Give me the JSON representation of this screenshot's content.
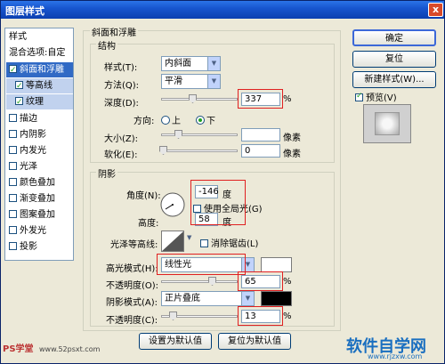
{
  "window": {
    "title": "图层样式",
    "close": "x"
  },
  "sidebar": {
    "items": [
      {
        "label": "样式",
        "checkbox": false
      },
      {
        "label": "混合选项:自定",
        "checkbox": false
      },
      {
        "label": "斜面和浮雕",
        "checkbox": true,
        "checked": true
      },
      {
        "label": "等高线",
        "checkbox": true,
        "checked": true
      },
      {
        "label": "纹理",
        "checkbox": true,
        "checked": true
      },
      {
        "label": "描边",
        "checkbox": true,
        "checked": false
      },
      {
        "label": "内阴影",
        "checkbox": true,
        "checked": false
      },
      {
        "label": "内发光",
        "checkbox": true,
        "checked": false
      },
      {
        "label": "光泽",
        "checkbox": true,
        "checked": false
      },
      {
        "label": "颜色叠加",
        "checkbox": true,
        "checked": false
      },
      {
        "label": "渐变叠加",
        "checkbox": true,
        "checked": false
      },
      {
        "label": "图案叠加",
        "checkbox": true,
        "checked": false
      },
      {
        "label": "外发光",
        "checkbox": true,
        "checked": false
      },
      {
        "label": "投影",
        "checkbox": true,
        "checked": false
      }
    ]
  },
  "bevel": {
    "section_title": "斜面和浮雕",
    "structure_title": "结构",
    "style_label": "样式(T):",
    "style_value": "内斜面",
    "method_label": "方法(Q):",
    "method_value": "平滑",
    "depth_label": "深度(D):",
    "depth_value": "337",
    "depth_unit": "%",
    "direction_label": "方向:",
    "direction_up": "上",
    "direction_down": "下",
    "size_label": "大小(Z):",
    "size_value": "",
    "size_unit": "像素",
    "soften_label": "软化(E):",
    "soften_value": "0",
    "soften_unit": "像素"
  },
  "shading": {
    "title": "阴影",
    "angle_label": "角度(N):",
    "angle_value": "-146",
    "angle_unit": "度",
    "global_light_label": "使用全局光(G)",
    "altitude_label": "高度:",
    "altitude_value": "58",
    "altitude_unit": "度",
    "gloss_contour_label": "光泽等高线:",
    "antialias_label": "消除锯齿(L)",
    "highlight_mode_label": "高光模式(H):",
    "highlight_mode_value": "线性光",
    "highlight_opacity_label": "不透明度(O):",
    "highlight_opacity_value": "65",
    "highlight_opacity_unit": "%",
    "shadow_mode_label": "阴影模式(A):",
    "shadow_mode_value": "正片叠底",
    "shadow_opacity_label": "不透明度(C):",
    "shadow_opacity_value": "13",
    "shadow_opacity_unit": "%"
  },
  "buttons": {
    "make_default": "设置为默认值",
    "reset_default": "复位为默认值",
    "ok": "确定",
    "reset": "复位",
    "new_style": "新建样式(W)...",
    "preview": "预览(V)"
  },
  "watermarks": {
    "left": "PS学堂",
    "left_url": "www.52psxt.com",
    "right_brand": "软件自学网",
    "right_url": "www.rjzxw.com"
  },
  "colors": {
    "highlight": "#ffffff",
    "shadow": "#000000",
    "title_bar": "#1856cf",
    "accent_red": "#e02020"
  }
}
